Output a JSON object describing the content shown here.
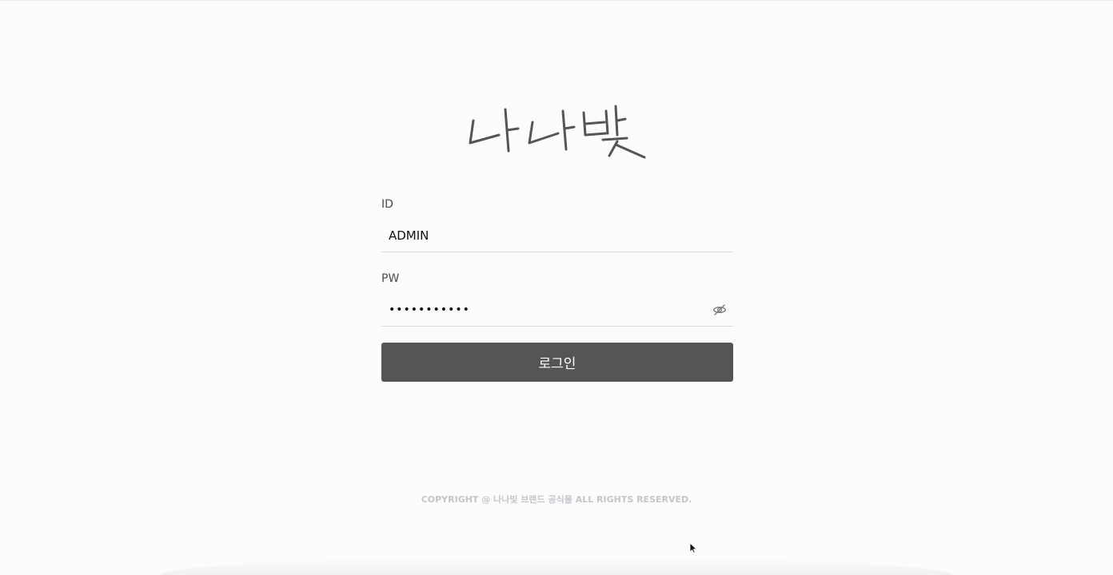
{
  "brand": {
    "logo_text": "나나빛"
  },
  "login_form": {
    "id_label": "ID",
    "id_value": "ADMIN",
    "pw_label": "PW",
    "pw_value": "dummypasswd",
    "pw_toggle_icon": "eye-slash-icon",
    "submit_label": "로그인"
  },
  "footer": {
    "copyright": "COPYRIGHT @ 나나빛 브랜드 공식몰 ALL RIGHTS RESERVED."
  },
  "colors": {
    "background": "#fcfcfc",
    "button_bg": "#555555",
    "button_text": "#ffffff",
    "underline": "#d9dbe6",
    "footer_text": "#c4c6cc"
  }
}
